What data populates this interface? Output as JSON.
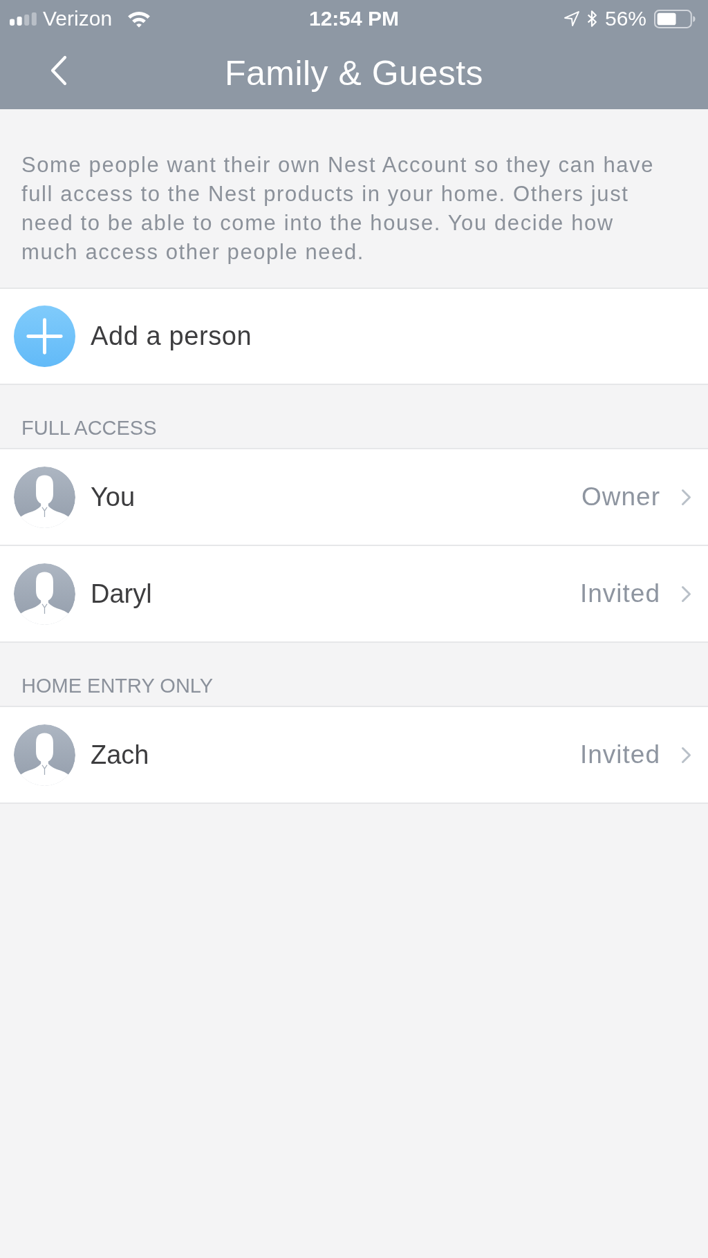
{
  "status_bar": {
    "carrier": "Verizon",
    "time": "12:54 PM",
    "battery": "56%"
  },
  "nav": {
    "title": "Family & Guests"
  },
  "intro": "Some people want their own Nest Account so they can have full access to the Nest products in your home. Others just need to be able to come into the house. You decide how much access other people need.",
  "add_row": {
    "label": "Add a person"
  },
  "sections": [
    {
      "title": "FULL ACCESS",
      "people": [
        {
          "name": "You",
          "status": "Owner"
        },
        {
          "name": "Daryl",
          "status": "Invited"
        }
      ]
    },
    {
      "title": "HOME ENTRY ONLY",
      "people": [
        {
          "name": "Zach",
          "status": "Invited"
        }
      ]
    }
  ]
}
